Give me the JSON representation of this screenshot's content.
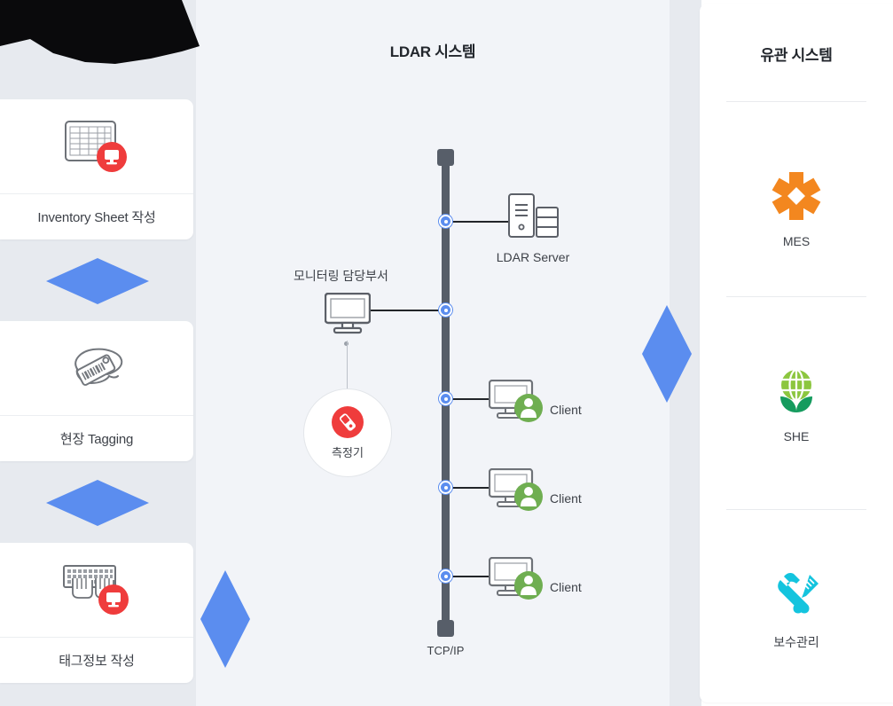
{
  "colors": {
    "accent_blue": "#5b8def",
    "bus_gray": "#575e69",
    "badge_red": "#ef3c3c",
    "client_green": "#6fae51",
    "mes_orange": "#f3871f",
    "she_green_light": "#8cc63f",
    "she_green_dark": "#159b5e",
    "maint_cyan": "#14c4de",
    "panel_left_bg": "#e7eaef",
    "panel_center_bg": "#f2f4f8",
    "card_bg": "#ffffff"
  },
  "workflow": {
    "cards": [
      {
        "label": "Inventory Sheet 작성",
        "icon": "spreadsheet-monitor-icon"
      },
      {
        "label": "현장 Tagging",
        "icon": "barcode-tag-icon"
      },
      {
        "label": "태그정보 작성",
        "icon": "keyboard-typing-monitor-icon"
      }
    ],
    "connectors": [
      {
        "icon": "blue-diamond-flat-icon"
      },
      {
        "icon": "blue-diamond-flat-icon"
      }
    ]
  },
  "center": {
    "title": "LDAR 시스템",
    "bus_label": "TCP/IP",
    "department": {
      "title": "모니터링 담당부서",
      "icon": "desktop-monitor-icon"
    },
    "meter": {
      "label": "측정기",
      "icon": "handheld-meter-icon"
    },
    "nodes": [
      {
        "label": "LDAR Server",
        "icon": "server-tower-icon"
      },
      {
        "label": "",
        "icon": "desktop-monitor-icon"
      },
      {
        "label": "Client",
        "icon": "client-monitor-user-icon"
      },
      {
        "label": "Client",
        "icon": "client-monitor-user-icon"
      },
      {
        "label": "Client",
        "icon": "client-monitor-user-icon"
      }
    ]
  },
  "bridges": [
    {
      "icon": "blue-diamond-tall-icon",
      "position": "left"
    },
    {
      "icon": "blue-diamond-tall-icon",
      "position": "right"
    }
  ],
  "related_systems": {
    "title": "유관 시스템",
    "items": [
      {
        "label": "MES",
        "icon": "mes-asterisk-icon"
      },
      {
        "label": "SHE",
        "icon": "she-globe-leaf-icon"
      },
      {
        "label": "보수관리",
        "icon": "wrench-screwdriver-icon"
      }
    ]
  }
}
